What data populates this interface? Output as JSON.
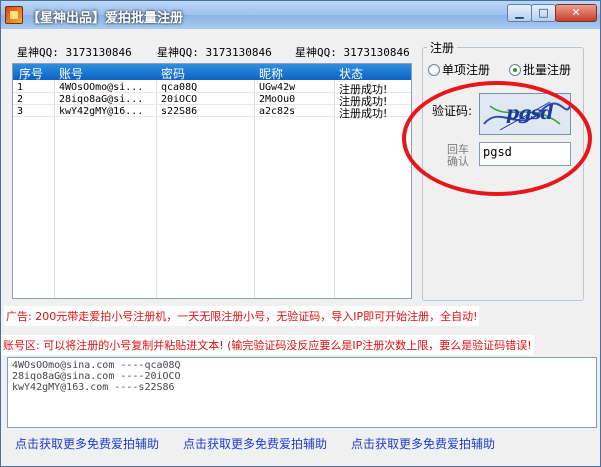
{
  "window": {
    "title": "【星神出品】爱拍批量注册",
    "minimize": "▁",
    "maximize": "□",
    "close": "✕"
  },
  "qq_labels": [
    "星神QQ: 3173130846",
    "星神QQ: 3173130846",
    "星神QQ: 3173130846"
  ],
  "table": {
    "headers": [
      "序号",
      "账号",
      "密码",
      "昵称",
      "状态"
    ],
    "rows": [
      [
        "1",
        "4WOsOOmo@si...",
        "qca08Q",
        "UGw42w",
        "注册成功!"
      ],
      [
        "2",
        "28iqo8aG@si...",
        "20iOCO",
        "2MoOu0",
        "注册成功!"
      ],
      [
        "3",
        "kwY42gMY@16...",
        "s22S86",
        "a2c82s",
        "注册成功!"
      ]
    ]
  },
  "register_group": {
    "title": "注册",
    "radio_single": "单项注册",
    "radio_batch": "批量注册",
    "selected": "批量注册"
  },
  "captcha": {
    "label": "验证码:",
    "image_text": "pgsd",
    "enter_label": "回车确认",
    "input_value": "pgsd"
  },
  "ads": {
    "line1": "广告: 200元带走爱拍小号注册机，一天无限注册小号，无验证码，导入IP即可开始注册，全自动!",
    "line2": "账号区: 可以将注册的小号复制并粘贴进文本! (输完验证码没反应要么是IP注册次数上限，要么是验证码错误!"
  },
  "log_lines": [
    "4WOsOOmo@sina.com ----qca08Q",
    "28iqo8aG@sina.com ----20iOCO",
    "kwY42gMY@163.com ----s22S86"
  ],
  "links": [
    "点击获取更多免费爱拍辅助",
    "点击获取更多免费爱拍辅助",
    "点击获取更多免费爱拍辅助"
  ],
  "colors": {
    "header_blue": "#0e62c2",
    "ad_red": "#e01010",
    "link_blue": "#1a3fd1",
    "highlight_red": "#e8151b"
  }
}
